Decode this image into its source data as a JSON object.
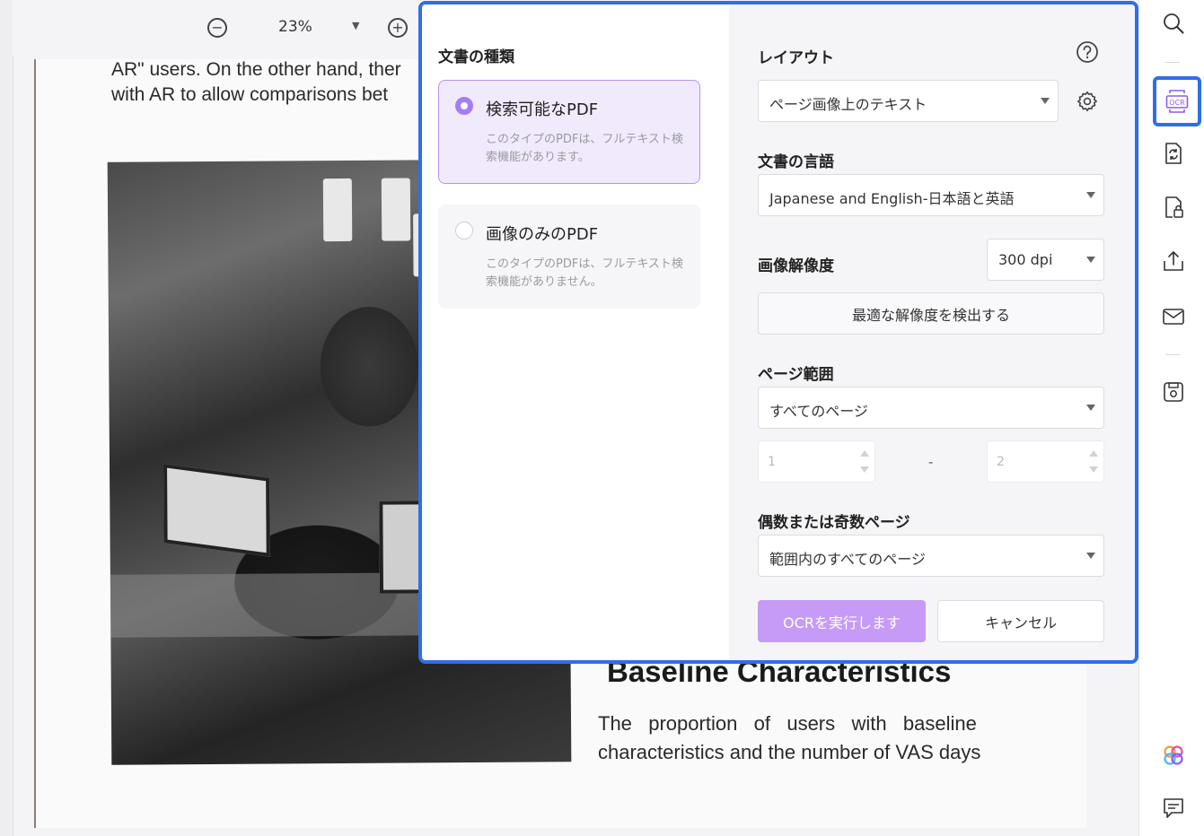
{
  "toolbar": {
    "zoom_value": "23%",
    "zoom_out_symbol": "−",
    "zoom_in_symbol": "+",
    "zoom_caret": "▼"
  },
  "document": {
    "top_line_1": "AR\" users. On the other hand, ther",
    "top_line_2": "with AR to allow comparisons bet",
    "heading": "Baseline Characteristics",
    "body_line_1": "The   proportion   of   users   with   baseline",
    "body_line_2": "characteristics and the number of VAS days"
  },
  "dialog": {
    "doc_type_label": "文書の種類",
    "options": [
      {
        "title": "検索可能なPDF",
        "desc": "このタイプのPDFは、フルテキスト検索機能があります。",
        "selected": true
      },
      {
        "title": "画像のみのPDF",
        "desc": "このタイプのPDFは、フルテキスト検索機能がありません。",
        "selected": false
      }
    ],
    "layout_label": "レイアウト",
    "layout_value": "ページ画像上のテキスト",
    "language_label": "文書の言語",
    "language_value": "Japanese and English-日本語と英語",
    "resolution_label": "画像解像度",
    "resolution_value": "300 dpi",
    "detect_button": "最適な解像度を検出する",
    "page_range_label": "ページ範囲",
    "page_range_value": "すべてのページ",
    "range_from": "1",
    "range_dash": "-",
    "range_to": "2",
    "odd_even_label": "偶数または奇数ページ",
    "odd_even_value": "範囲内のすべてのページ",
    "run_button": "OCRを実行します",
    "cancel_button": "キャンセル"
  },
  "colors": {
    "accent_purple": "#a67cf4",
    "run_button_bg": "#c59bf7",
    "focus_blue": "#2f6fe6"
  },
  "sidebar": {
    "icons": [
      "search-icon",
      "ocr-icon",
      "convert-icon",
      "protect-icon",
      "share-icon",
      "email-icon",
      "save-icon",
      "ai-assistant-icon",
      "comment-icon"
    ]
  }
}
